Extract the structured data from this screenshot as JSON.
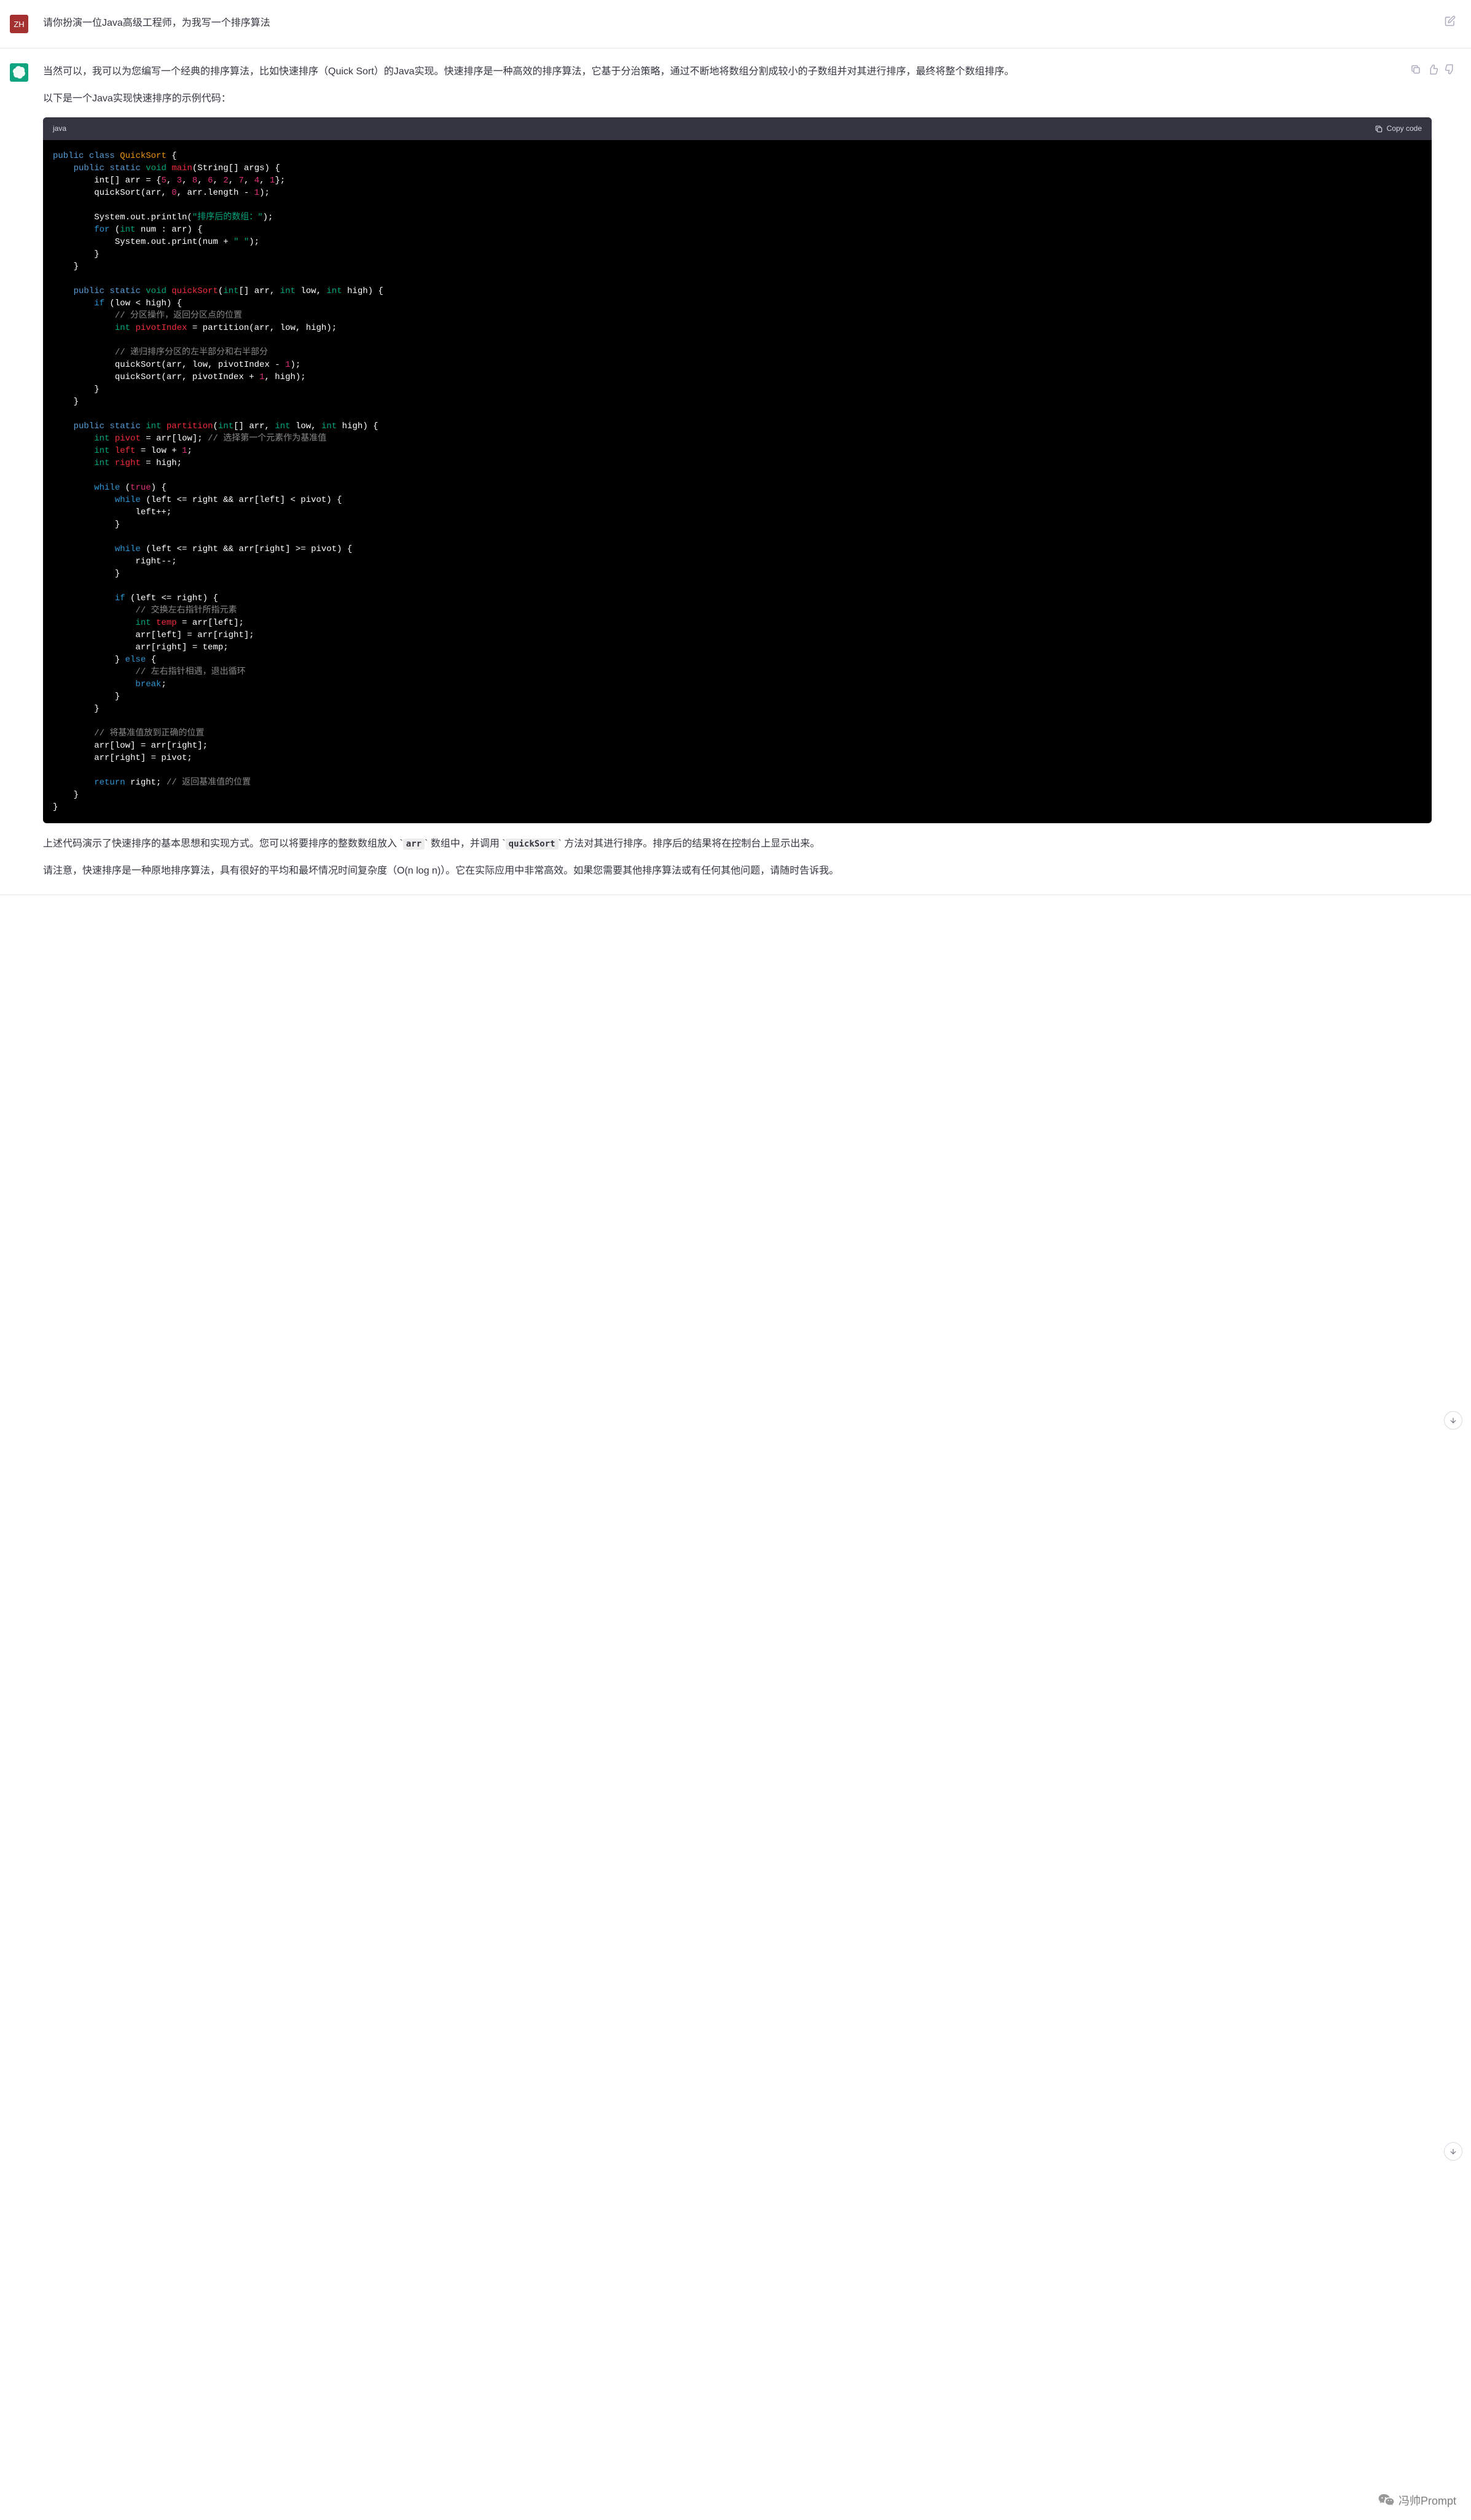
{
  "user": {
    "avatar_text": "ZH",
    "message": "请你扮演一位Java高级工程师，为我写一个排序算法"
  },
  "assistant": {
    "p1": "当然可以，我可以为您编写一个经典的排序算法，比如快速排序（Quick Sort）的Java实现。快速排序是一种高效的排序算法，它基于分治策略，通过不断地将数组分割成较小的子数组并对其进行排序，最终将整个数组排序。",
    "p2": "以下是一个Java实现快速排序的示例代码：",
    "code_lang": "java",
    "copy_label": "Copy code",
    "code": {
      "class_name": "QuickSort",
      "main_sig": "main",
      "main_args": "String[] args",
      "arr_decl": "int[] arr = {",
      "arr_values": [
        "5",
        "3",
        "8",
        "6",
        "2",
        "7",
        "4",
        "1"
      ],
      "qs_call1": "quickSort(arr, ",
      "qs_call1_arg0": "0",
      "qs_call1_rest": ", arr.length - ",
      "qs_call1_arg1": "1",
      "println_prefix": "System.out.println(",
      "println_str": "\"排序后的数组：\"",
      "for_line": "for (int num : arr) {",
      "print_line_pre": "System.out.print(num + ",
      "print_line_str": "\" \"",
      "qs_sig": "quickSort",
      "qs_args": "int[] arr, int low, int high",
      "if_cond": "if (low < high) {",
      "comment1": "// 分区操作，返回分区点的位置",
      "pivot_idx_pre": "int pivotIndex = partition(arr, low, high);",
      "comment2": "// 递归排序分区的左半部分和右半部分",
      "qs_rec1": "quickSort(arr, low, pivotIndex - ",
      "qs_rec1_n": "1",
      "qs_rec2": "quickSort(arr, pivotIndex + ",
      "qs_rec2_n": "1",
      "qs_rec2_rest": ", high);",
      "part_sig": "partition",
      "part_args": "int[] arr, int low, int high",
      "pivot_line": "int pivot = arr[low]; ",
      "pivot_comment": "// 选择第一个元素作为基准值",
      "left_line": "int left = low + ",
      "left_n": "1",
      "right_line": "int right = high;",
      "while_true": "while (true) {",
      "while_left": "while (left <= right && arr[left] < pivot) {",
      "left_inc": "left++;",
      "while_right": "while (left <= right && arr[right] >= pivot) {",
      "right_dec": "right--;",
      "if_lr": "if (left <= right) {",
      "comment3": "// 交换左右指针所指元素",
      "temp_line": "int temp = arr[left];",
      "swap1": "arr[left] = arr[right];",
      "swap2": "arr[right] = temp;",
      "else_line": "} else {",
      "comment4": "// 左右指针相遇，退出循环",
      "break_line": "break;",
      "comment5": "// 将基准值放到正确的位置",
      "swap3": "arr[low] = arr[right];",
      "swap4": "arr[right] = pivot;",
      "return_line": "return right; ",
      "return_comment": "// 返回基准值的位置"
    },
    "p3_pre": "上述代码演示了快速排序的基本思想和实现方式。您可以将要排序的整数数组放入 ",
    "p3_code1": "arr",
    "p3_mid": " 数组中，并调用 ",
    "p3_code2": "quickSort",
    "p3_post": " 方法对其进行排序。排序后的结果将在控制台上显示出来。",
    "p4": "请注意，快速排序是一种原地排序算法，具有很好的平均和最坏情况时间复杂度（O(n log n)）。它在实际应用中非常高效。如果您需要其他排序算法或有任何其他问题，请随时告诉我。"
  },
  "watermark": "冯帅Prompt"
}
